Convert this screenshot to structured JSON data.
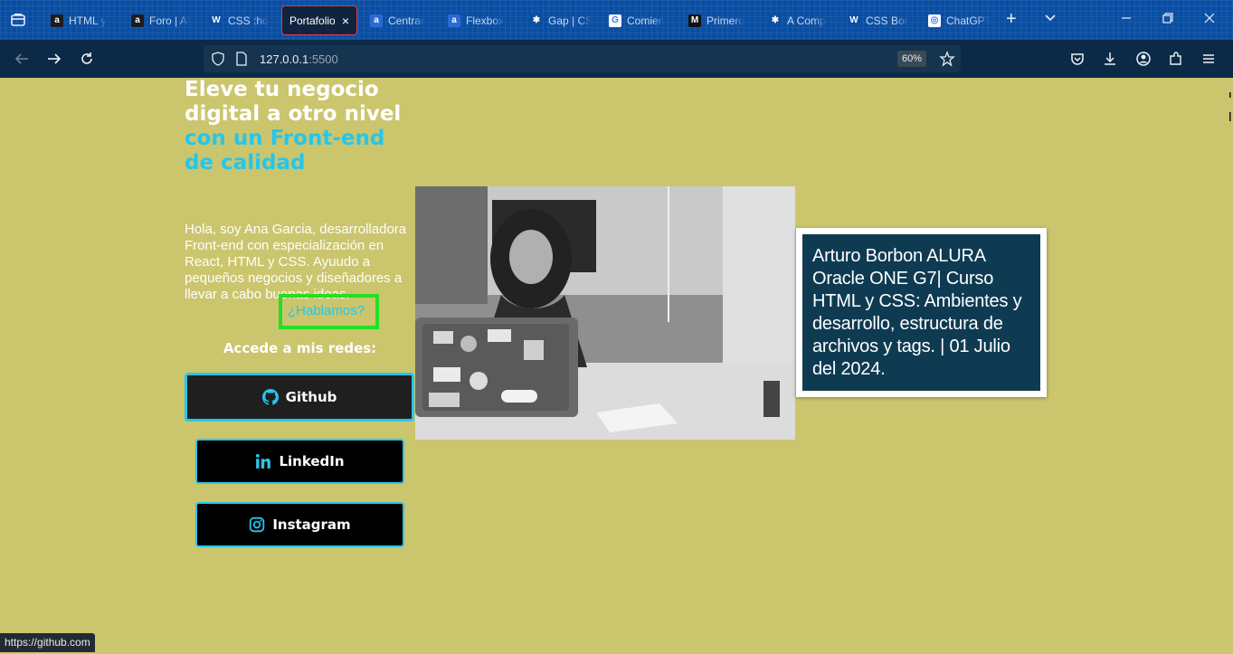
{
  "browser": {
    "tabs": [
      {
        "title": "HTML y",
        "favicon": "alura-icon",
        "fav_bg": "#1d1d1d",
        "fav_char": "a"
      },
      {
        "title": "Foro | Al",
        "favicon": "alura-icon",
        "fav_bg": "#1d1d1d",
        "fav_char": "a"
      },
      {
        "title": "CSS :ho",
        "favicon": "w3-icon",
        "fav_bg": "#0a4ea3",
        "fav_char": "W"
      },
      {
        "title": "Portafolio",
        "favicon": "none",
        "fav_bg": "",
        "fav_char": "",
        "active": true
      },
      {
        "title": "Centrar",
        "favicon": "alura-blue-icon",
        "fav_bg": "#2a6ad8",
        "fav_char": "a"
      },
      {
        "title": "Flexbox",
        "favicon": "alura-blue-icon",
        "fav_bg": "#2a6ad8",
        "fav_char": "a"
      },
      {
        "title": "Gap | CS",
        "favicon": "asterisk-icon",
        "fav_bg": "#0a4ea3",
        "fav_char": "✱"
      },
      {
        "title": "Comien",
        "favicon": "google-icon",
        "fav_bg": "#ffffff",
        "fav_char": "G"
      },
      {
        "title": "Primero",
        "favicon": "medium-icon",
        "fav_bg": "#111111",
        "fav_char": "M"
      },
      {
        "title": "A Comp",
        "favicon": "asterisk-icon",
        "fav_bg": "#0a4ea3",
        "fav_char": "✱"
      },
      {
        "title": "CSS Bor",
        "favicon": "w3-icon",
        "fav_bg": "#0a4ea3",
        "fav_char": "W"
      },
      {
        "title": "ChatGPT",
        "favicon": "chatgpt-icon",
        "fav_bg": "#ffffff",
        "fav_char": "◎"
      }
    ],
    "url_host": "127.0.0.1",
    "url_port": ":5500",
    "zoom": "60%",
    "status_url": "https://github.com"
  },
  "page": {
    "headline_white": "Eleve tu negocio digital a otro nivel ",
    "headline_accent": "con un Front-end de calidad",
    "intro": "Hola, soy Ana Garcia, desarrolladora Front-end con especialización en React, HTML y CSS. Ayuudo a pequeños negocios y diseñadores a llevar a cabo buenas ideas.",
    "hablamos": "¿Hablamos?",
    "redes_title": "Accede a mis redes:",
    "social": {
      "github": "Github",
      "linkedin": "LinkedIn",
      "instagram": "Instagram"
    }
  },
  "caption": "Arturo Borbon ALURA Oracle ONE G7| Curso HTML y CSS: Ambientes y desarrollo, estructura de archivos y tags. | 01 Julio del 2024.",
  "colors": {
    "page_bg": "#cbc56e",
    "accent": "#26c6ea",
    "highlight_box": "#22e022",
    "caption_bg": "#0e3b52"
  }
}
